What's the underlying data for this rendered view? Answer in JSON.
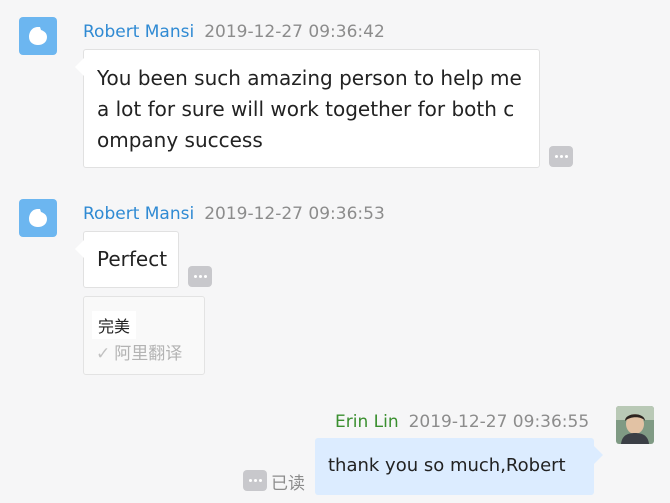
{
  "messages": [
    {
      "sender": "Robert Mansi",
      "time": "2019-12-27 09:36:42",
      "lines": [
        "You been such amazing person to help me",
        " a lot for sure will work together for both c",
        "ompany success"
      ]
    },
    {
      "sender": "Robert Mansi",
      "time": "2019-12-27 09:36:53",
      "text": "Perfect",
      "translation": {
        "result": "完美",
        "source": "阿里翻译"
      }
    },
    {
      "sender": "Erin Lin",
      "time": "2019-12-27 09:36:55",
      "text": "thank you so much,Robert",
      "read_status": "已读"
    }
  ],
  "icons": {
    "contact_avatar": "chat-bubble-avatar-icon",
    "more": "more-dots-icon",
    "check": "check-icon",
    "user_photo": "user-photo-avatar"
  },
  "colors": {
    "contact_name": "#2f8ad3",
    "self_name": "#3a8f2f",
    "self_bubble": "#dcecff",
    "avatar_bg": "#6cb6f0"
  }
}
